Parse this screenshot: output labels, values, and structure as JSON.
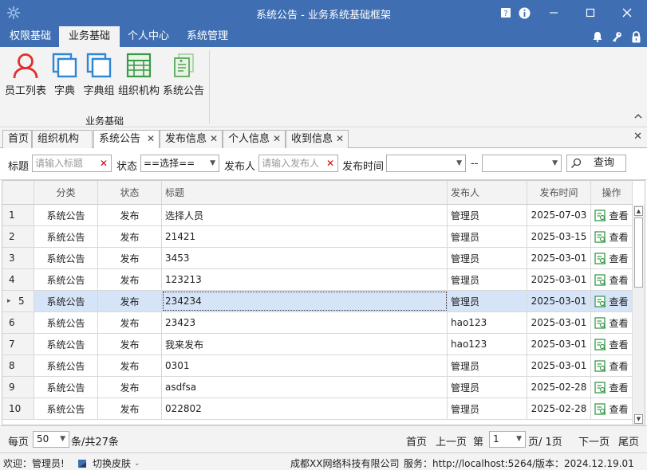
{
  "window": {
    "title": "系统公告 - 业务系统基础框架"
  },
  "menubar": {
    "items": [
      {
        "label": "权限基础"
      },
      {
        "label": "业务基础"
      },
      {
        "label": "个人中心"
      },
      {
        "label": "系统管理"
      }
    ]
  },
  "ribbon": {
    "buttons": [
      {
        "label": "员工列表",
        "icon": "user-icon"
      },
      {
        "label": "字典",
        "icon": "dictionary-icon"
      },
      {
        "label": "字典组",
        "icon": "dictionary-group-icon"
      },
      {
        "label": "组织机构",
        "icon": "organization-icon"
      },
      {
        "label": "系统公告",
        "icon": "announcement-icon"
      }
    ],
    "group_label": "业务基础"
  },
  "tabs": [
    {
      "label": "首页",
      "closable": false
    },
    {
      "label": "组织机构",
      "closable": false
    },
    {
      "label": "系统公告",
      "closable": true,
      "active": true
    },
    {
      "label": "发布信息",
      "closable": true
    },
    {
      "label": "个人信息",
      "closable": true
    },
    {
      "label": "收到信息",
      "closable": true
    }
  ],
  "filter": {
    "title_label": "标题",
    "title_placeholder": "请输入标题",
    "status_label": "状态",
    "status_value": "==选择==",
    "publisher_label": "发布人",
    "publisher_placeholder": "请输入发布人",
    "time_label": "发布时间",
    "time_from": "",
    "time_sep": "--",
    "time_to": "",
    "query_label": "查询"
  },
  "grid": {
    "columns": [
      "分类",
      "状态",
      "标题",
      "发布人",
      "发布时间",
      "操作"
    ],
    "action_label": "查看",
    "rows": [
      {
        "no": "1",
        "category": "系统公告",
        "status": "发布",
        "title": "选择人员",
        "publisher": "管理员",
        "time": "2025-07-03"
      },
      {
        "no": "2",
        "category": "系统公告",
        "status": "发布",
        "title": "21421",
        "publisher": "管理员",
        "time": "2025-03-15"
      },
      {
        "no": "3",
        "category": "系统公告",
        "status": "发布",
        "title": "3453",
        "publisher": "管理员",
        "time": "2025-03-01"
      },
      {
        "no": "4",
        "category": "系统公告",
        "status": "发布",
        "title": "123213",
        "publisher": "管理员",
        "time": "2025-03-01"
      },
      {
        "no": "5",
        "category": "系统公告",
        "status": "发布",
        "title": "234234",
        "publisher": "管理员",
        "time": "2025-03-01",
        "selected": true
      },
      {
        "no": "6",
        "category": "系统公告",
        "status": "发布",
        "title": "23423",
        "publisher": "hao123",
        "time": "2025-03-01"
      },
      {
        "no": "7",
        "category": "系统公告",
        "status": "发布",
        "title": "我来发布",
        "publisher": "hao123",
        "time": "2025-03-01"
      },
      {
        "no": "8",
        "category": "系统公告",
        "status": "发布",
        "title": "0301",
        "publisher": "管理员",
        "time": "2025-03-01"
      },
      {
        "no": "9",
        "category": "系统公告",
        "status": "发布",
        "title": "asdfsa",
        "publisher": "管理员",
        "time": "2025-02-28"
      },
      {
        "no": "10",
        "category": "系统公告",
        "status": "发布",
        "title": "022802",
        "publisher": "管理员",
        "time": "2025-02-28"
      }
    ]
  },
  "pager": {
    "per_page_label": "每页",
    "per_page_value": "50",
    "total_text": "条/共27条",
    "first": "首页",
    "prev": "上一页",
    "page_label": "第",
    "page_value": "1",
    "page_total": "页/ 1页",
    "next": "下一页",
    "last": "尾页"
  },
  "status": {
    "welcome": "欢迎：管理员!",
    "skin": "切换皮肤",
    "company": "成都XX网络科技有限公司",
    "service": "服务：http://localhost:5264/",
    "version": "版本：2024.12.19.01"
  },
  "colors": {
    "accent": "#3f6fb2",
    "selected_row": "#d6e4f8",
    "ribbon_bg": "#f3f3f3",
    "icon_red": "#e03030",
    "icon_blue": "#2e86d6",
    "icon_green": "#3a9a4a"
  }
}
